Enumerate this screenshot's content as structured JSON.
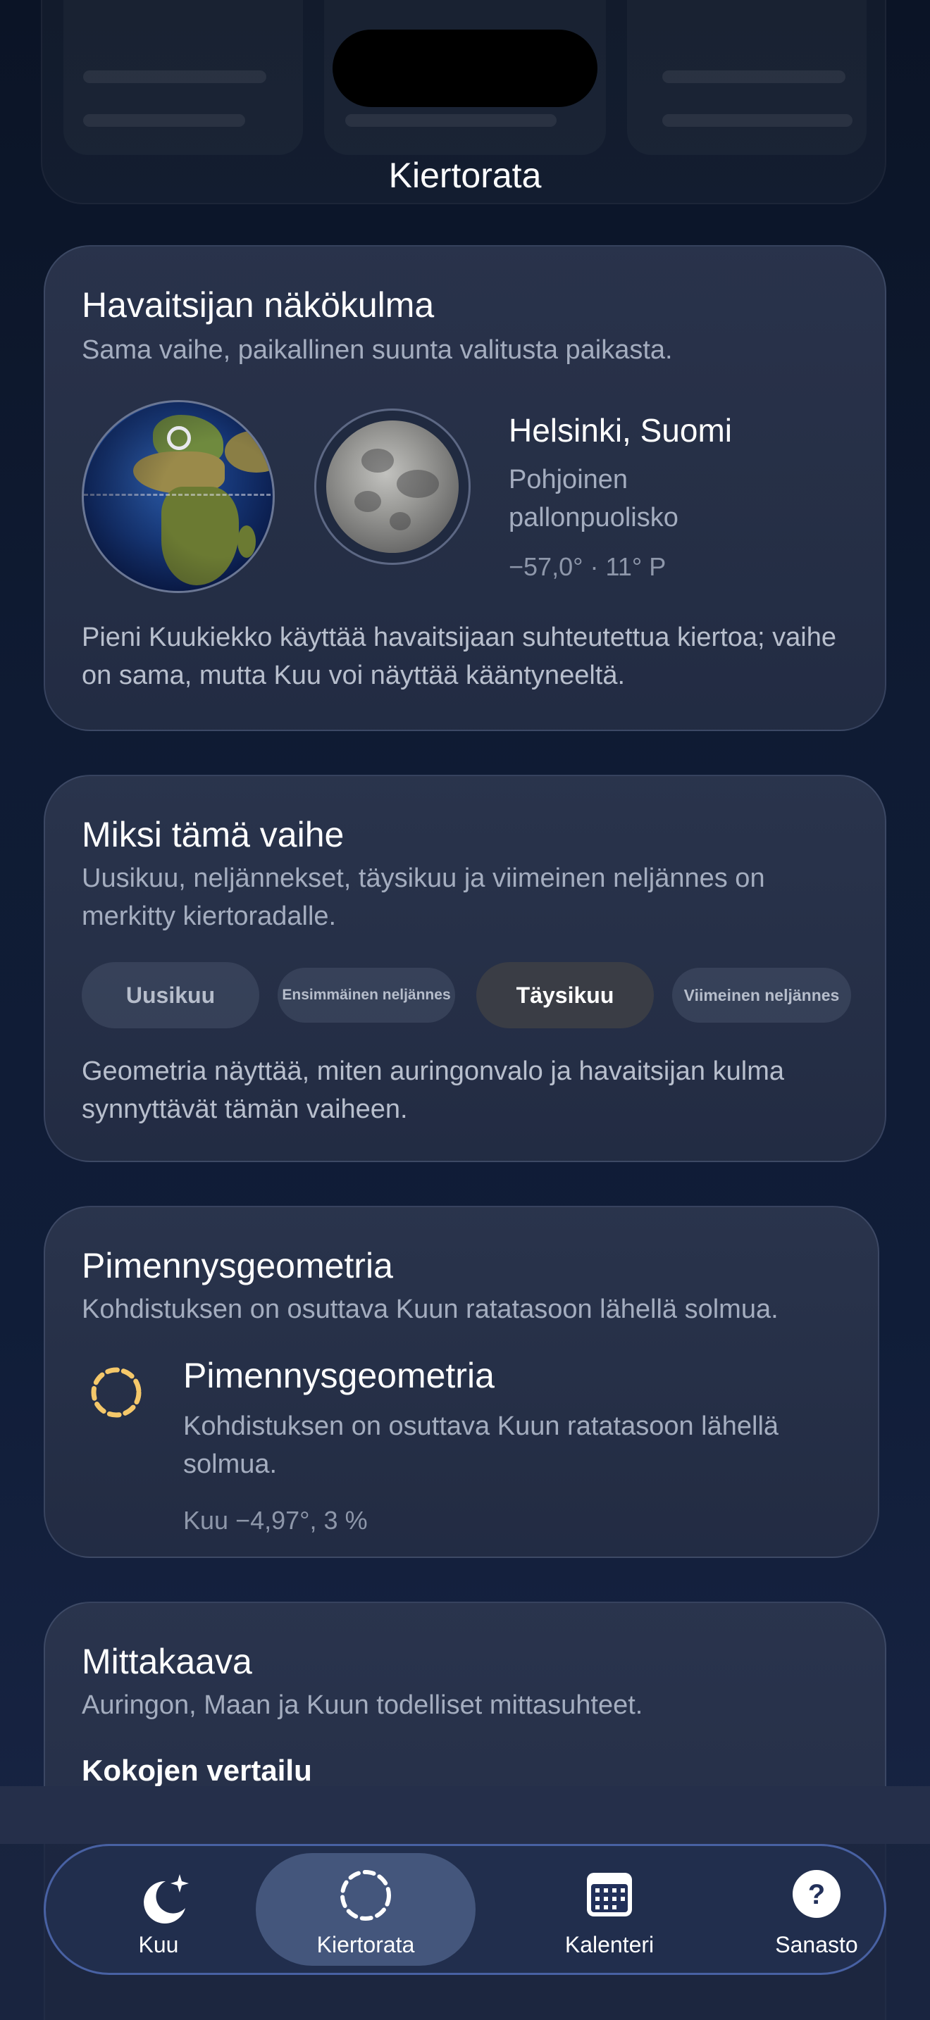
{
  "nav": {
    "title": "Kiertorata"
  },
  "observer_card": {
    "title": "Havaitsijan näkökulma",
    "subtitle": "Sama vaihe, paikallinen suunta valitusta paikasta.",
    "location": "Helsinki, Suomi",
    "hemisphere": "Pohjoinen pallonpuolisko",
    "coordinates": "−57,0° · 11° P",
    "body": "Pieni Kuukiekko käyttää havaitsijaan suhteutettua kiertoa; vaihe on sama, mutta Kuu voi näyttää kääntyneeltä."
  },
  "phase_card": {
    "title": "Miksi tämä vaihe",
    "subtitle": "Uusikuu, neljännekset, täysikuu ja viimeinen neljännes on merkitty kiertoradalle.",
    "phases": [
      {
        "label": "Uusikuu",
        "active": false
      },
      {
        "label": "Ensimmäinen neljännes",
        "active": false
      },
      {
        "label": "Täysikuu",
        "active": true
      },
      {
        "label": "Viimeinen neljännes",
        "active": false
      }
    ],
    "body": "Geometria näyttää, miten auringonvalo ja havaitsijan kulma synnyttävät tämän vaiheen."
  },
  "eclipse_card": {
    "title": "Pimennysgeometria",
    "subtitle": "Kohdistuksen on osuttava Kuun ratatasoon lähellä solmua.",
    "item_title": "Pimennysgeometria",
    "item_text": "Kohdistuksen on osuttava Kuun ratatasoon lähellä solmua.",
    "item_meta": "Kuu −4,97°, 3 %",
    "icon": "dashed-orbit-icon",
    "icon_color": "#f5c86a"
  },
  "scale_card": {
    "title": "Mittakaava",
    "subtitle": "Auringon, Maan ja Kuun todelliset mittasuhteet.",
    "section_heading": "Kokojen vertailu"
  },
  "tabbar": {
    "tabs": [
      {
        "label": "Kuu",
        "icon": "moon-stars-icon",
        "active": false
      },
      {
        "label": "Kiertorata",
        "icon": "orbit-icon",
        "active": true
      },
      {
        "label": "Kalenteri",
        "icon": "calendar-icon",
        "active": false
      },
      {
        "label": "Sanasto",
        "icon": "question-icon",
        "active": false
      }
    ]
  },
  "colors": {
    "accent": "#f5c86a",
    "background": "#0f1b33"
  }
}
